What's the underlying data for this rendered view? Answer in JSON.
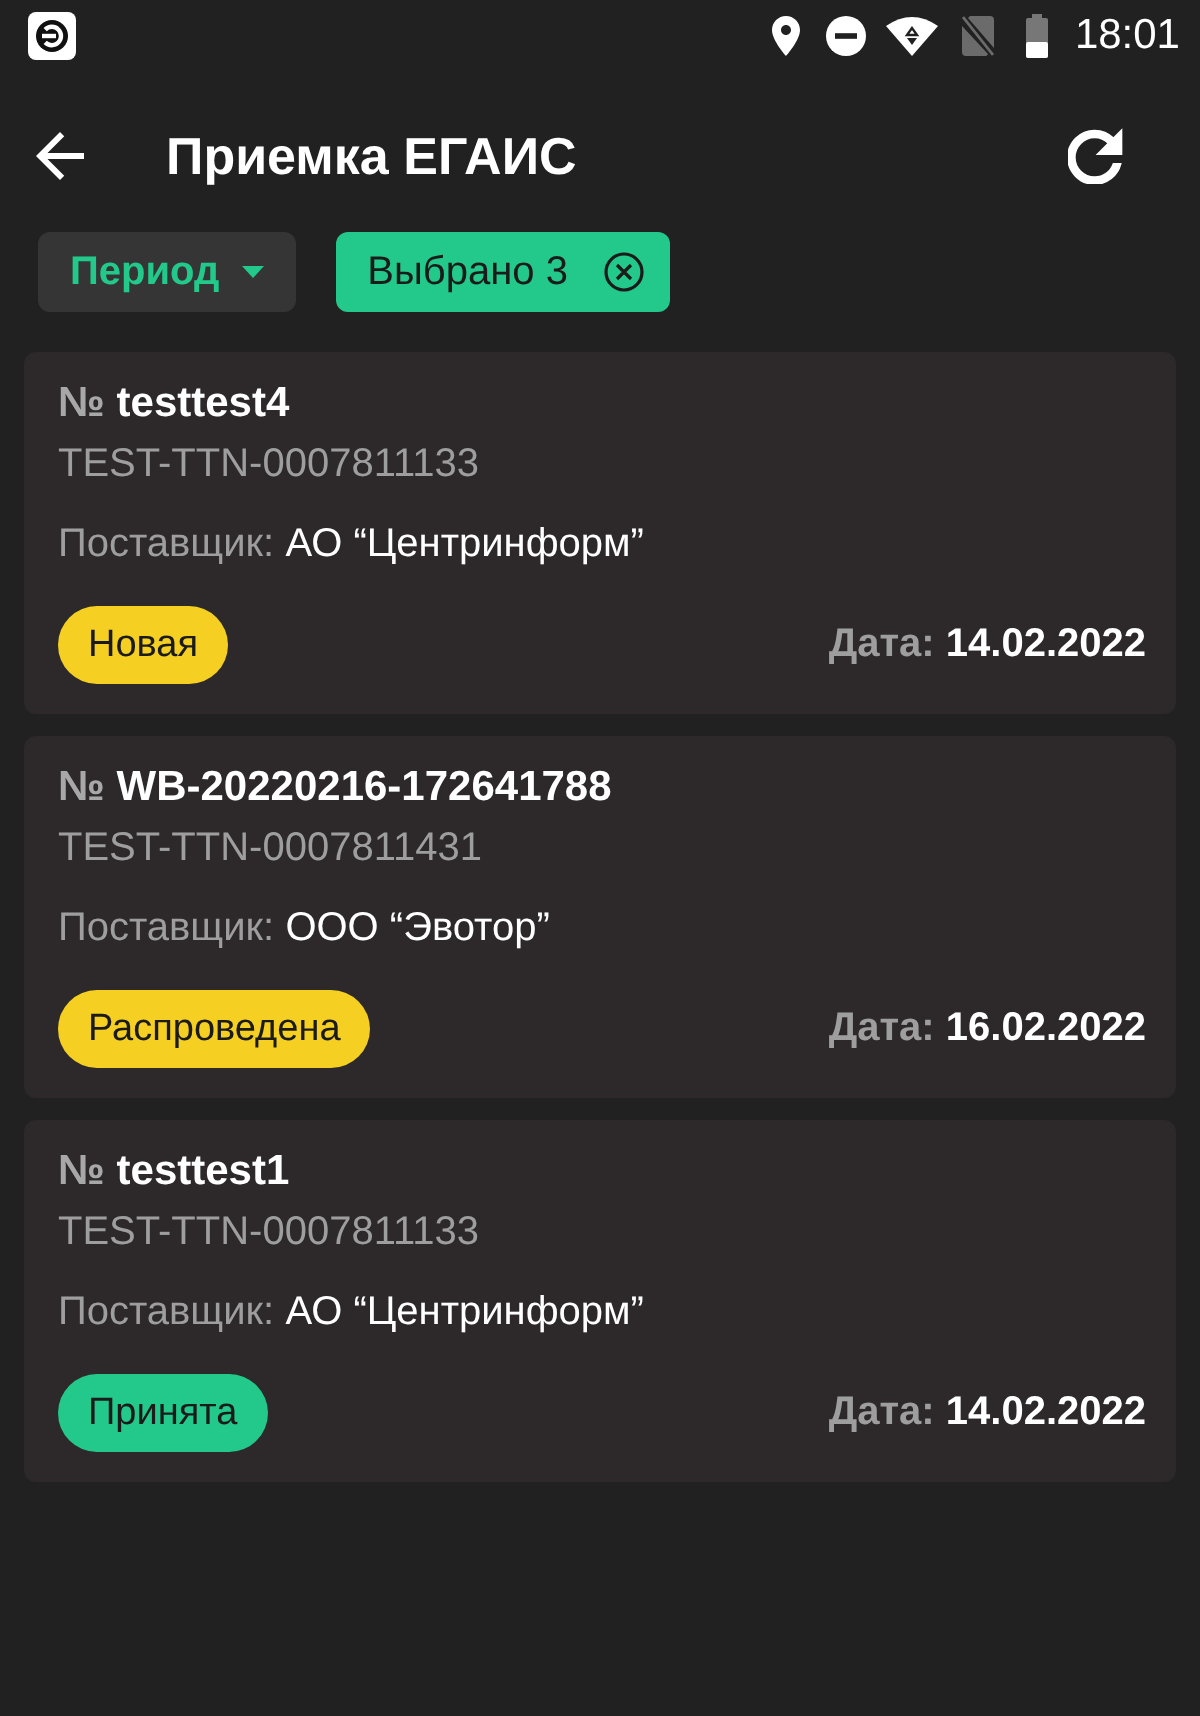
{
  "status_bar": {
    "time": "18:01"
  },
  "app_bar": {
    "title": "Приемка ЕГАИС"
  },
  "filters": [
    {
      "kind": "dropdown",
      "label": "Период"
    },
    {
      "kind": "selection",
      "label": "Выбрано 3"
    }
  ],
  "documents": [
    {
      "number_sign": "№",
      "number": "testtest4",
      "waybill": "TEST-TTN-0007811133",
      "supplier_label": "Поставщик:",
      "supplier": "АО “Центринформ”",
      "status": {
        "label": "Новая",
        "color": "#f5d022"
      },
      "date_label": "Дата:",
      "date": "14.02.2022"
    },
    {
      "number_sign": "№",
      "number": "WB-20220216-172641788",
      "waybill": "TEST-TTN-0007811431",
      "supplier_label": "Поставщик:",
      "supplier": "ООО “Эвотор”",
      "status": {
        "label": "Распроведена",
        "color": "#f5d022"
      },
      "date_label": "Дата:",
      "date": "16.02.2022"
    },
    {
      "number_sign": "№",
      "number": "testtest1",
      "waybill": "TEST-TTN-0007811133",
      "supplier_label": "Поставщик:",
      "supplier": "АО “Центринформ”",
      "status": {
        "label": "Принята",
        "color": "#22c98b"
      },
      "date_label": "Дата:",
      "date": "14.02.2022"
    }
  ]
}
